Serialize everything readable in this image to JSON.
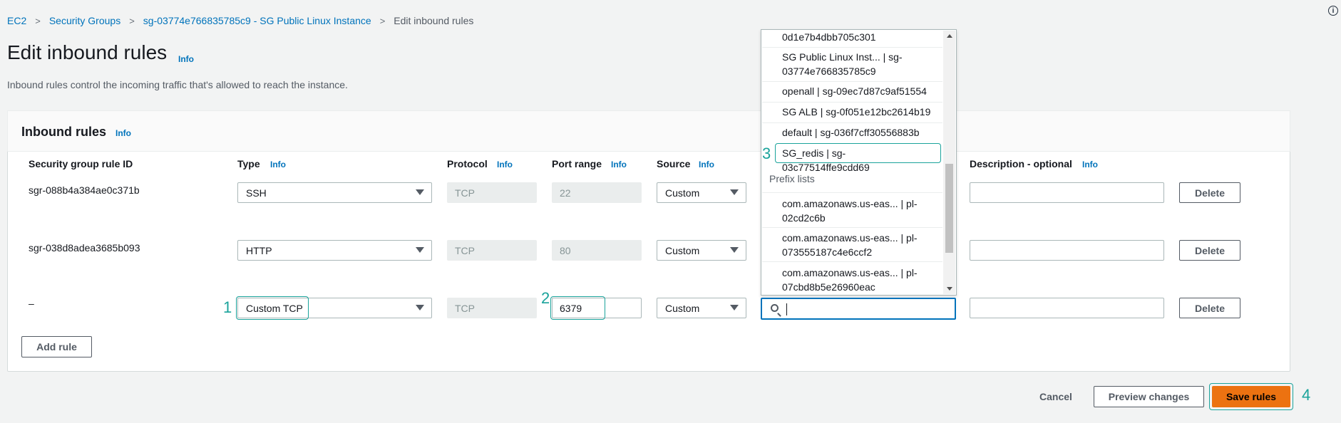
{
  "breadcrumb": {
    "items": [
      "EC2",
      "Security Groups",
      "sg-03774e766835785c9 - SG Public Linux Instance"
    ],
    "separator": ">",
    "current": "Edit inbound rules"
  },
  "page": {
    "title": "Edit inbound rules",
    "info": "Info",
    "description": "Inbound rules control the incoming traffic that's allowed to reach the instance.",
    "top_right_icon": "i"
  },
  "panel": {
    "title": "Inbound rules",
    "info": "Info",
    "columns": {
      "rule_id": "Security group rule ID",
      "type": "Type",
      "protocol": "Protocol",
      "port_range": "Port range",
      "source": "Source",
      "description": "Description - optional",
      "info": "Info"
    },
    "rules": [
      {
        "id": "sgr-088b4a384ae0c371b",
        "type": "SSH",
        "protocol": "TCP",
        "port": "22",
        "source": "Custom",
        "delete": "Delete"
      },
      {
        "id": "sgr-038d8adea3685b093",
        "type": "HTTP",
        "protocol": "TCP",
        "port": "80",
        "source": "Custom",
        "delete": "Delete"
      },
      {
        "id": "–",
        "type": "Custom TCP",
        "protocol": "TCP",
        "port": "6379",
        "source": "Custom",
        "delete": "Delete"
      }
    ],
    "add_rule": "Add rule"
  },
  "dropdown": {
    "items": [
      "0d1e7b4dbb705c301",
      "SG Public Linux Inst... | sg-03774e766835785c9",
      "openall | sg-09ec7d87c9af51554",
      "SG ALB | sg-0f051e12bc2614b19",
      "default | sg-036f7cff30556883b",
      "SG_redis | sg-03c77514ffe9cdd69"
    ],
    "prefix_group": "Prefix lists",
    "prefix_items": [
      "com.amazonaws.us-eas... | pl-02cd2c6b",
      "com.amazonaws.us-eas... | pl-073555187c4e6ccf2",
      "com.amazonaws.us-eas... | pl-07cbd8b5e26960eac"
    ],
    "search_value": ""
  },
  "annotations": [
    "1",
    "2",
    "3",
    "4"
  ],
  "footer": {
    "cancel": "Cancel",
    "preview": "Preview changes",
    "save": "Save rules"
  },
  "colors": {
    "primary": "#ec7211",
    "link": "#0073bb",
    "annotation": "#1aa39b",
    "focus": "#0073bb"
  }
}
